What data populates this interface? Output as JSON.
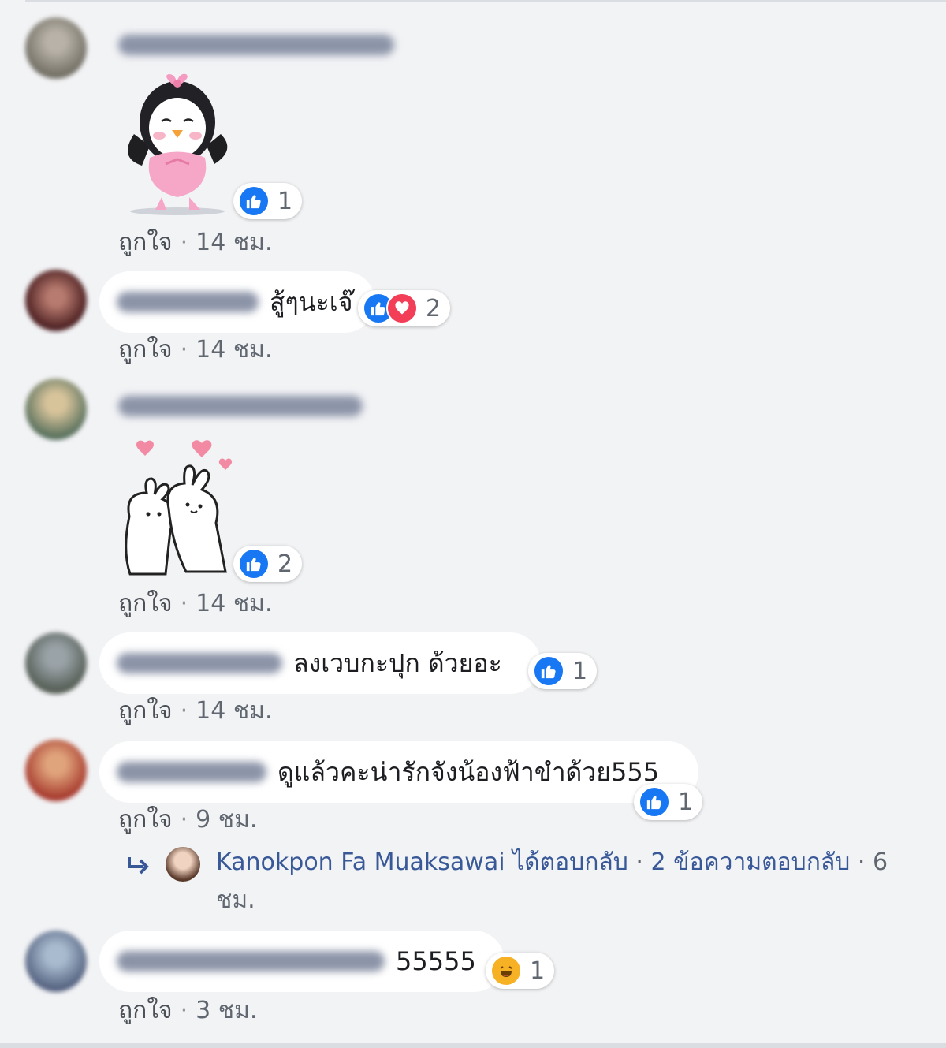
{
  "comments": [
    {
      "type": "sticker",
      "sticker": "ballerina-penguin",
      "reactions": {
        "icons": [
          "like-icon"
        ],
        "count": "1"
      },
      "meta": {
        "like": "ถูกใจ",
        "sep": "·",
        "time": "14 ชม."
      }
    },
    {
      "type": "text",
      "text": "สู้ๆนะเจ๊",
      "reactions": {
        "icons": [
          "like-icon",
          "love-icon"
        ],
        "count": "2"
      },
      "meta": {
        "like": "ถูกใจ",
        "sep": "·",
        "time": "14 ชม."
      }
    },
    {
      "type": "sticker",
      "sticker": "hugging-rabbits-hearts",
      "reactions": {
        "icons": [
          "like-icon"
        ],
        "count": "2"
      },
      "meta": {
        "like": "ถูกใจ",
        "sep": "·",
        "time": "14 ชม."
      }
    },
    {
      "type": "text",
      "text": "ลงเวบกะปุก ด้วยอะ",
      "reactions": {
        "icons": [
          "like-icon"
        ],
        "count": "1"
      },
      "meta": {
        "like": "ถูกใจ",
        "sep": "·",
        "time": "14 ชม."
      }
    },
    {
      "type": "text",
      "text": "ดูแล้วคะน่ารักจังน้องฟ้าขำด้วย555",
      "reactions": {
        "icons": [
          "like-icon"
        ],
        "count": "1"
      },
      "meta": {
        "like": "ถูกใจ",
        "sep": "·",
        "time": "9 ชม."
      },
      "reply": {
        "name": "Kanokpon Fa Muaksawai",
        "action": "ได้ตอบกลับ",
        "sep": "·",
        "count_text": "2 ข้อความตอบกลับ",
        "sep2": "·",
        "time_a": "6",
        "time_b": "ชม."
      }
    },
    {
      "type": "text",
      "text": "55555",
      "reactions": {
        "icons": [
          "haha-icon"
        ],
        "count": "1"
      },
      "meta": {
        "like": "ถูกใจ",
        "sep": "·",
        "time": "3 ชม."
      }
    }
  ],
  "colors": {
    "like": "#1877f2",
    "love": "#f33e58",
    "haha": "#f7b125",
    "bubble": "#ffffff",
    "background": "#f2f3f5"
  }
}
